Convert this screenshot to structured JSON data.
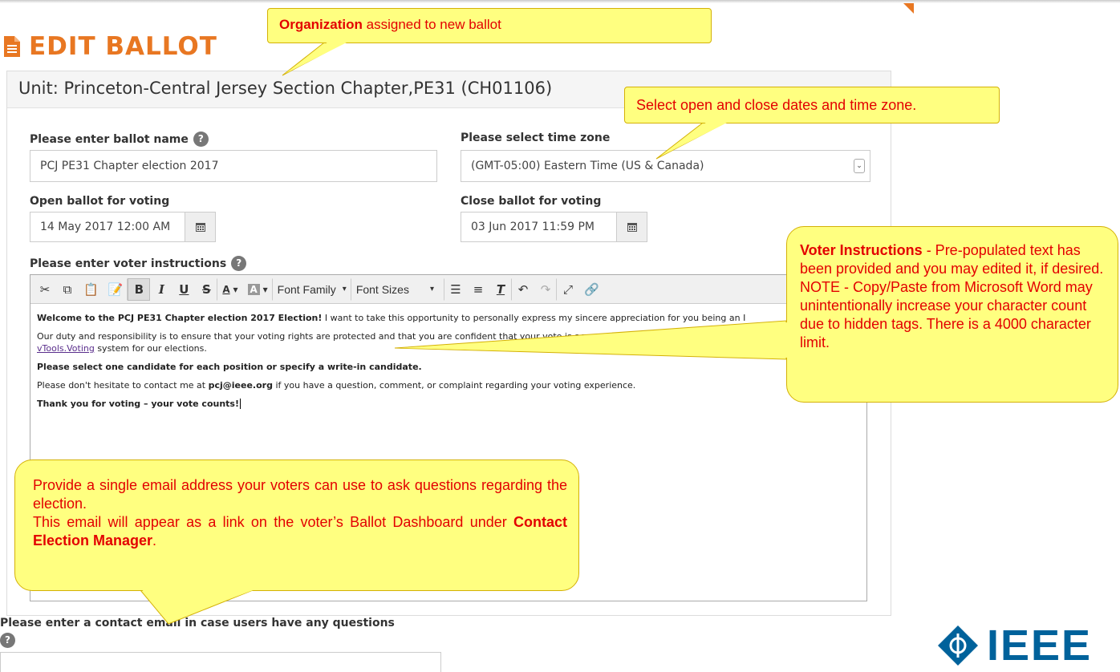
{
  "page": {
    "title": "EDIT BALLOT",
    "unit": "Unit: Princeton-Central Jersey Section Chapter,PE31 (CH01106)"
  },
  "form": {
    "ballot_name_label": "Please enter ballot name",
    "ballot_name_value": "PCJ PE31 Chapter election 2017",
    "timezone_label": "Please select time zone",
    "timezone_value": "(GMT-05:00) Eastern Time (US & Canada)",
    "open_label": "Open ballot for voting",
    "open_value": "14 May 2017 12:00 AM",
    "close_label": "Close ballot for voting",
    "close_value": "03 Jun 2017 11:59 PM",
    "instructions_label": "Please enter voter instructions",
    "contact_label": "Please enter a contact email in case users have any questions",
    "contact_value": ""
  },
  "editor": {
    "font_family": "Font Family",
    "font_sizes": "Font Sizes",
    "p1_bold": "Welcome to the PCJ PE31 Chapter election 2017 Election!",
    "p1_rest": " I want to take this opportunity to personally express my sincere appreciation for you being an I",
    "p2_text": "Our duty and responsibility is to ensure that your voting rights are protected and that you are confident that your vote is accurately",
    "p2_link": "vTools.Voting",
    "p2_tail": " system for our elections.",
    "p3": "Please select one candidate for each position or specify a write-in candidate.",
    "p4_pre": "Please don't hesitate to contact me at ",
    "p4_email": "pcj@ieee.org",
    "p4_post": " if you have a question, comment, or complaint regarding your voting experience.",
    "p5": "Thank you for voting – your vote counts!"
  },
  "callouts": {
    "org_bold": "Organization",
    "org_rest": " assigned to new ballot",
    "dates": "Select open and close dates and time zone.",
    "voter_bold": "Voter Instructions",
    "voter_rest": " - Pre-populated text has been provided and you  may edited it, if desired.",
    "voter_note": "NOTE - Copy/Paste  from Microsoft Word may unintentionally increase your character count due to hidden tags. There is a 4000 character limit.",
    "email_line1": "Provide a single email address your voters can use to ask questions regarding the election.",
    "email_line2": "This email will appear as a link on the voter’s Ballot Dashboard under ",
    "email_bold": "Contact Election Manager",
    "email_end": "."
  },
  "logo": {
    "text": "IEEE"
  },
  "colors": {
    "accent": "#e87722",
    "callout_fill": "#ffff80",
    "callout_text": "#e30000",
    "ieee_blue": "#00629b"
  }
}
